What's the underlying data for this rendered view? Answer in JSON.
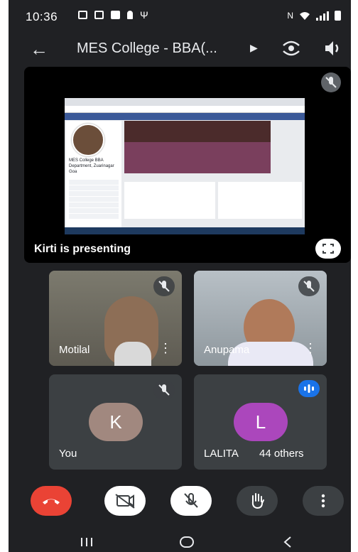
{
  "status_bar": {
    "time": "10:36"
  },
  "app_bar": {
    "title": "MES College - BBA(..."
  },
  "presentation": {
    "label": "Kirti is presenting",
    "shared_screen": {
      "page_name": "MES College BBA Department, Zuarinagar Goa"
    }
  },
  "tiles": [
    {
      "name": "Motilal"
    },
    {
      "name": "Anupama"
    },
    {
      "name": "You",
      "initial": "K",
      "avatar_color": "#a1887f"
    },
    {
      "name": "LALITA",
      "initial": "L",
      "avatar_color": "#ab47bc",
      "others_label": "44 others"
    }
  ],
  "colors": {
    "background": "#202124",
    "end_call": "#ea4335",
    "speaking": "#1a73e8"
  }
}
